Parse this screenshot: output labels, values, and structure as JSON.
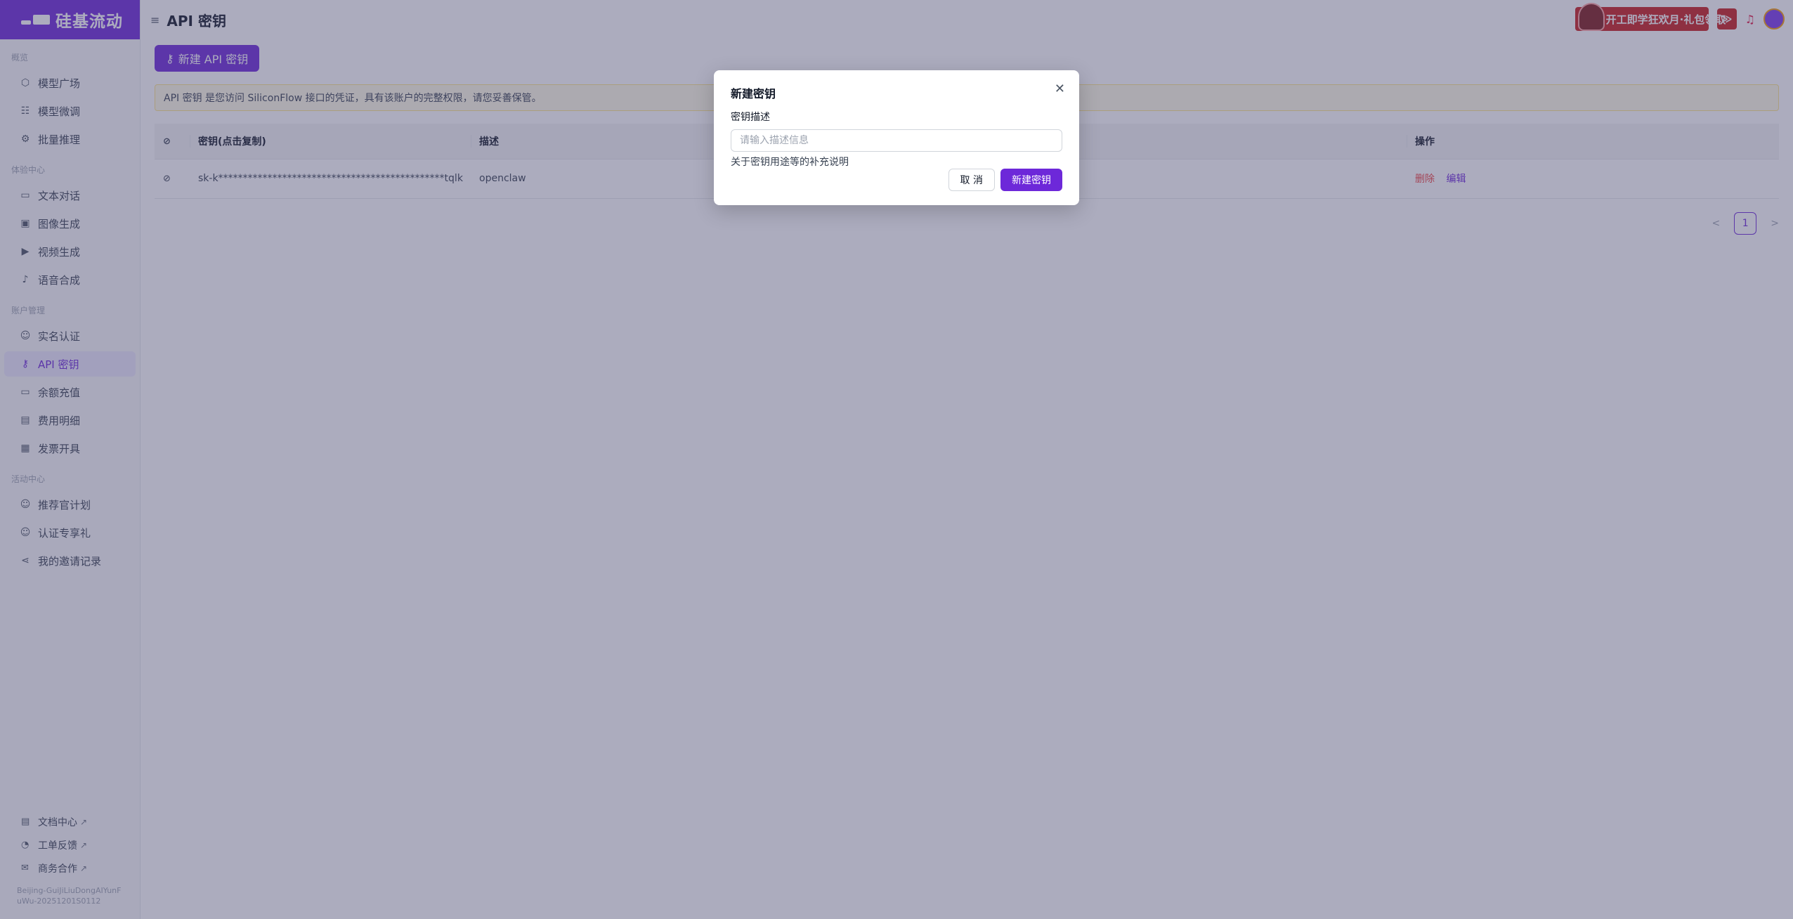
{
  "brand": {
    "name": "硅基流动"
  },
  "sidebar": {
    "sections": [
      {
        "title": "概览",
        "items": [
          {
            "label": "模型广场",
            "icon": "cube-icon"
          },
          {
            "label": "模型微调",
            "icon": "sliders-icon"
          },
          {
            "label": "批量推理",
            "icon": "batch-icon"
          }
        ]
      },
      {
        "title": "体验中心",
        "items": [
          {
            "label": "文本对话",
            "icon": "chat-icon"
          },
          {
            "label": "图像生成",
            "icon": "image-icon"
          },
          {
            "label": "视频生成",
            "icon": "video-icon"
          },
          {
            "label": "语音合成",
            "icon": "microphone-icon"
          }
        ]
      },
      {
        "title": "账户管理",
        "items": [
          {
            "label": "实名认证",
            "icon": "user-check-icon"
          },
          {
            "label": "API 密钥",
            "icon": "key-icon"
          },
          {
            "label": "余额充值",
            "icon": "credit-card-icon"
          },
          {
            "label": "费用明细",
            "icon": "receipt-icon"
          },
          {
            "label": "发票开具",
            "icon": "invoice-icon"
          }
        ]
      },
      {
        "title": "活动中心",
        "items": [
          {
            "label": "推荐官计划",
            "icon": "user-plus-icon"
          },
          {
            "label": "认证专享礼",
            "icon": "gift-user-icon"
          },
          {
            "label": "我的邀请记录",
            "icon": "share-icon"
          }
        ]
      }
    ],
    "bottom_links": [
      {
        "label": "文档中心",
        "icon": "doc-icon"
      },
      {
        "label": "工单反馈",
        "icon": "help-icon"
      },
      {
        "label": "商务合作",
        "icon": "handshake-icon"
      }
    ],
    "version": "Beijing-GuiJiLiuDongAIYunFuWu-20251201S0112"
  },
  "header": {
    "title": "API 密钥",
    "promo_text": "开工即学狂欢月·礼包领取",
    "promo_arrow": "≫"
  },
  "main": {
    "new_key_button": "新建 API 密钥",
    "notice": "API 密钥 是您访问 SiliconFlow 接口的凭证，具有该账户的完整权限，请您妥善保管。",
    "table": {
      "headers": {
        "key": "密钥(点击复制)",
        "description": "描述",
        "actions": "操作"
      },
      "rows": [
        {
          "key": "sk-k**********************************************tqlk",
          "description": "openclaw",
          "delete": "删除",
          "edit": "编辑"
        }
      ]
    },
    "pagination": {
      "prev": "<",
      "current": "1",
      "next": ">"
    }
  },
  "modal": {
    "title": "新建密钥",
    "field_label": "密钥描述",
    "input_placeholder": "请输入描述信息",
    "input_value": "",
    "help_text": "关于密钥用途等的补充说明",
    "cancel_label": "取 消",
    "confirm_label": "新建密钥"
  },
  "colors": {
    "accent": "#6d28d9",
    "danger": "#ef4444",
    "promo": "#c81e1e"
  }
}
